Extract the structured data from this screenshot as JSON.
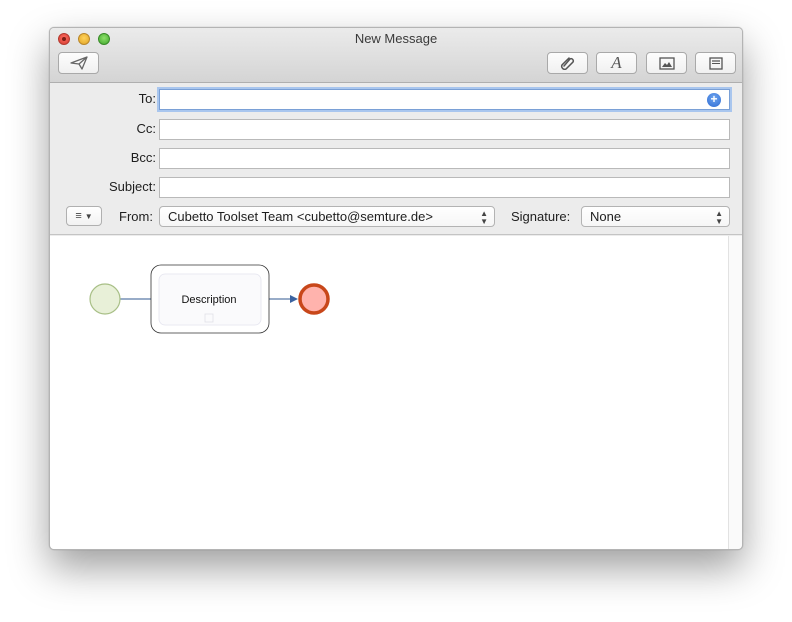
{
  "window": {
    "title": "New Message"
  },
  "toolbar": {
    "send_icon": "paper-plane-icon",
    "attach_icon": "paperclip-icon",
    "format_icon": "font-icon",
    "photo_icon": "photo-browser-icon",
    "template_icon": "stationery-icon"
  },
  "fields": {
    "to_label": "To:",
    "to_value": "",
    "cc_label": "Cc:",
    "cc_value": "",
    "bcc_label": "Bcc:",
    "bcc_value": "",
    "subject_label": "Subject:",
    "subject_value": ""
  },
  "from": {
    "label": "From:",
    "value": "Cubetto Toolset Team <cubetto@semture.de>"
  },
  "signature": {
    "label": "Signature:",
    "value": "None"
  },
  "diagram": {
    "task_label": "Description",
    "start_color": "#e8f0d8",
    "end_color": "#c8471a"
  }
}
